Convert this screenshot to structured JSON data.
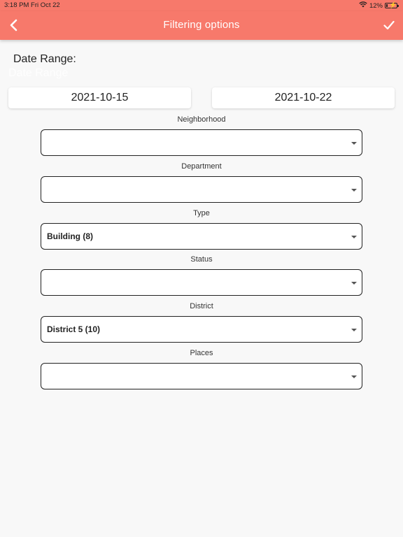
{
  "status_bar": {
    "time_date": "3:18 PM   Fri Oct 22",
    "battery": "12%",
    "battery_level": 0.12
  },
  "app_bar": {
    "title": "Filtering options",
    "back_icon": "chevron-left-icon",
    "confirm_icon": "checkmark-icon",
    "background": "#f7796b"
  },
  "date_range": {
    "label": "Date Range:",
    "ghost_label": "Date Range",
    "start": "2021-10-15",
    "end": "2021-10-22"
  },
  "filters": [
    {
      "label": "Neighborhood",
      "value": ""
    },
    {
      "label": "Department",
      "value": ""
    },
    {
      "label": "Type",
      "value": "Building (8)"
    },
    {
      "label": "Status",
      "value": ""
    },
    {
      "label": "District",
      "value": "District 5 (10)"
    },
    {
      "label": "Places",
      "value": ""
    }
  ]
}
